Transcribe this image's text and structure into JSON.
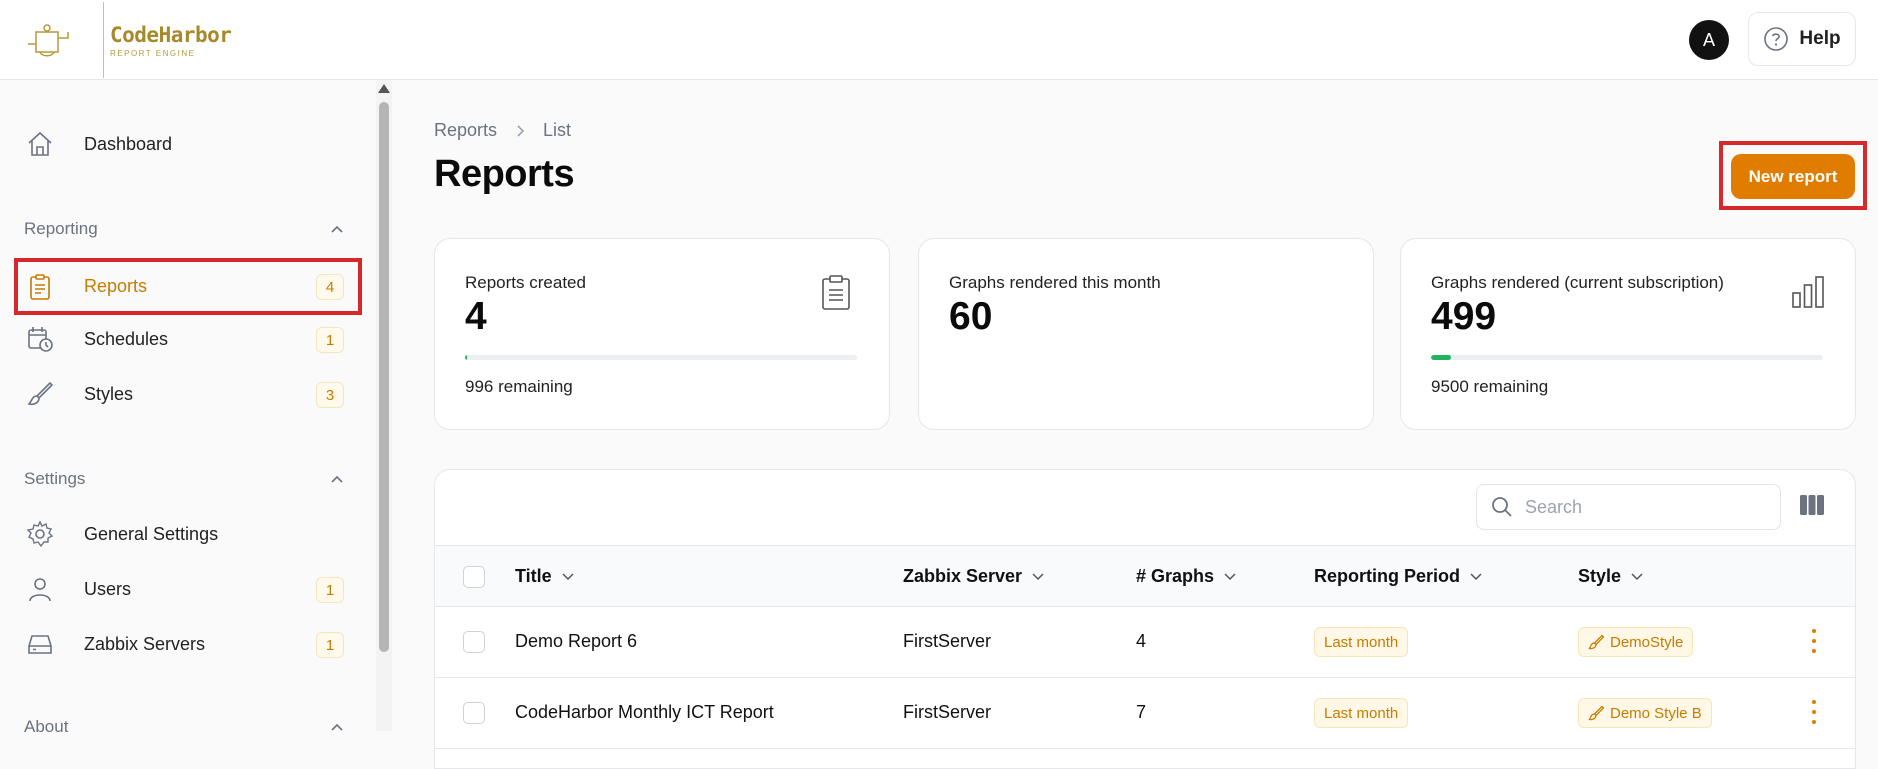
{
  "brand": {
    "name": "CodeHarbor",
    "tagline": "REPORT ENGINE"
  },
  "header": {
    "avatar_letter": "A",
    "help_label": "Help"
  },
  "sidebar": {
    "dashboard": {
      "label": "Dashboard"
    },
    "reporting_section": {
      "label": "Reporting"
    },
    "reporting_items": [
      {
        "label": "Reports",
        "count": "4",
        "icon": "clipboard-icon",
        "active": true
      },
      {
        "label": "Schedules",
        "count": "1",
        "icon": "calendar-clock-icon"
      },
      {
        "label": "Styles",
        "count": "3",
        "icon": "brush-icon"
      }
    ],
    "settings_section": {
      "label": "Settings"
    },
    "settings_items": [
      {
        "label": "General Settings",
        "icon": "gear-icon"
      },
      {
        "label": "Users",
        "count": "1",
        "icon": "user-icon"
      },
      {
        "label": "Zabbix Servers",
        "count": "1",
        "icon": "server-icon"
      }
    ],
    "about_section": {
      "label": "About"
    }
  },
  "breadcrumb": {
    "root": "Reports",
    "current": "List"
  },
  "page": {
    "title": "Reports",
    "new_report_label": "New report"
  },
  "stats": [
    {
      "label": "Reports created",
      "value": "4",
      "remaining": "996 remaining",
      "progress": 0.004,
      "icon": "clipboard-icon"
    },
    {
      "label": "Graphs rendered this month",
      "value": "60"
    },
    {
      "label": "Graphs rendered (current subscription)",
      "value": "499",
      "remaining": "9500 remaining",
      "progress": 0.05,
      "icon": "bar-chart-icon"
    }
  ],
  "table": {
    "search_placeholder": "Search",
    "columns": [
      "Title",
      "Zabbix Server",
      "# Graphs",
      "Reporting Period",
      "Style"
    ],
    "rows": [
      {
        "title": "Demo Report 6",
        "server": "FirstServer",
        "graphs": "4",
        "period": "Last month",
        "style": "DemoStyle"
      },
      {
        "title": "CodeHarbor Monthly ICT Report",
        "server": "FirstServer",
        "graphs": "7",
        "period": "Last month",
        "style": "Demo Style B"
      }
    ]
  },
  "colors": {
    "accent": "#e07c00",
    "highlight": "#d62828",
    "progress": "#22b35e"
  }
}
